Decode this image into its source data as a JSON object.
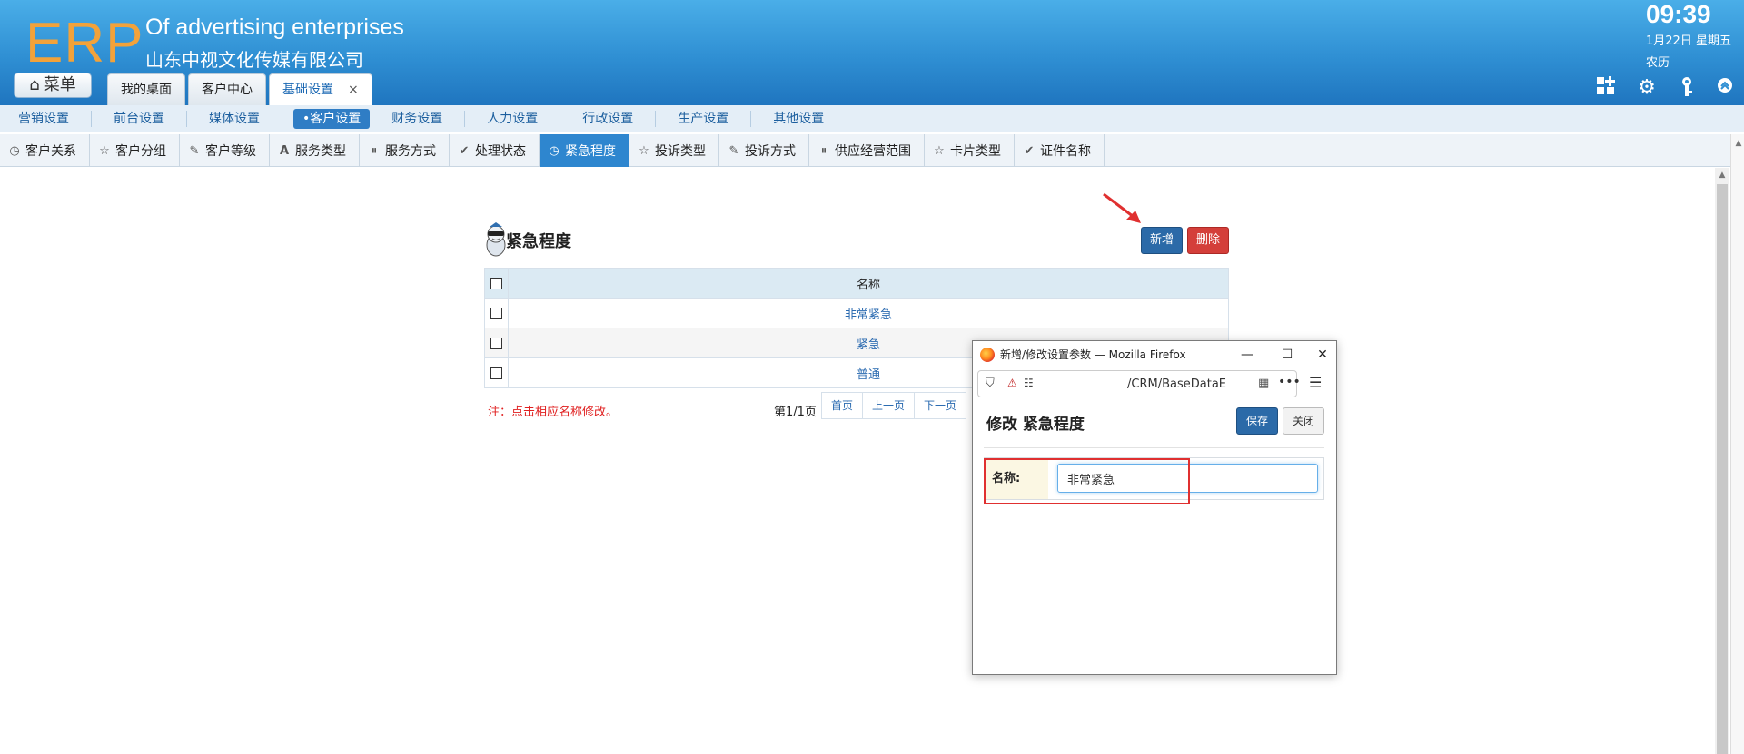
{
  "header": {
    "logo": "ERP",
    "company_en": "Of advertising enterprises",
    "company_cn": "山东中视文化传媒有限公司",
    "menu_label": "菜单",
    "clock": "09:39",
    "date": "1月22日 星期五",
    "lunar": "农历",
    "tabs": [
      {
        "label": "我的桌面"
      },
      {
        "label": "客户中心"
      },
      {
        "label": "基础设置",
        "close": "×"
      }
    ],
    "icons": [
      "apps-icon",
      "gear-icon",
      "key-icon",
      "chevron-up-icon"
    ]
  },
  "subnav": [
    "营销设置",
    "前台设置",
    "媒体设置",
    "•客户设置",
    "财务设置",
    "人力设置",
    "行政设置",
    "生产设置",
    "其他设置"
  ],
  "functabs": [
    {
      "label": "客户关系",
      "icon": "clock-icon"
    },
    {
      "label": "客户分组",
      "icon": "star-icon"
    },
    {
      "label": "客户等级",
      "icon": "pencil-icon"
    },
    {
      "label": "服务类型",
      "icon": "font-icon"
    },
    {
      "label": "服务方式",
      "icon": "pause-icon"
    },
    {
      "label": "处理状态",
      "icon": "check-icon"
    },
    {
      "label": "紧急程度",
      "icon": "clock-icon"
    },
    {
      "label": "投诉类型",
      "icon": "star-icon"
    },
    {
      "label": "投诉方式",
      "icon": "pencil-icon"
    },
    {
      "label": "供应经营范围",
      "icon": "pause-icon"
    },
    {
      "label": "卡片类型",
      "icon": "star-icon"
    },
    {
      "label": "证件名称",
      "icon": "check-icon"
    }
  ],
  "main": {
    "title": "紧急程度",
    "add_label": "新增",
    "delete_label": "删除",
    "table": {
      "header": "名称",
      "rows": [
        "非常紧急",
        "紧急",
        "普通"
      ]
    },
    "note": "注：点击相应名称修改。",
    "pager": {
      "info": "第1/1页",
      "buttons": [
        "首页",
        "上一页",
        "下一页"
      ]
    }
  },
  "popup": {
    "window_title": "新增/修改设置参数 — Mozilla Firefox",
    "url": "/CRM/BaseDataE",
    "form_title": "修改 紧急程度",
    "save_label": "保存",
    "close_label": "关闭",
    "field_label": "名称:",
    "field_value": "非常紧急"
  },
  "colors": {
    "header_blue": "#2f8fd3",
    "logo_orange": "#f2a23a",
    "primary_button": "#2b6aa8",
    "danger_button": "#d43f3a",
    "active_tab": "#2e86cf",
    "annotation_red": "#e03030"
  }
}
